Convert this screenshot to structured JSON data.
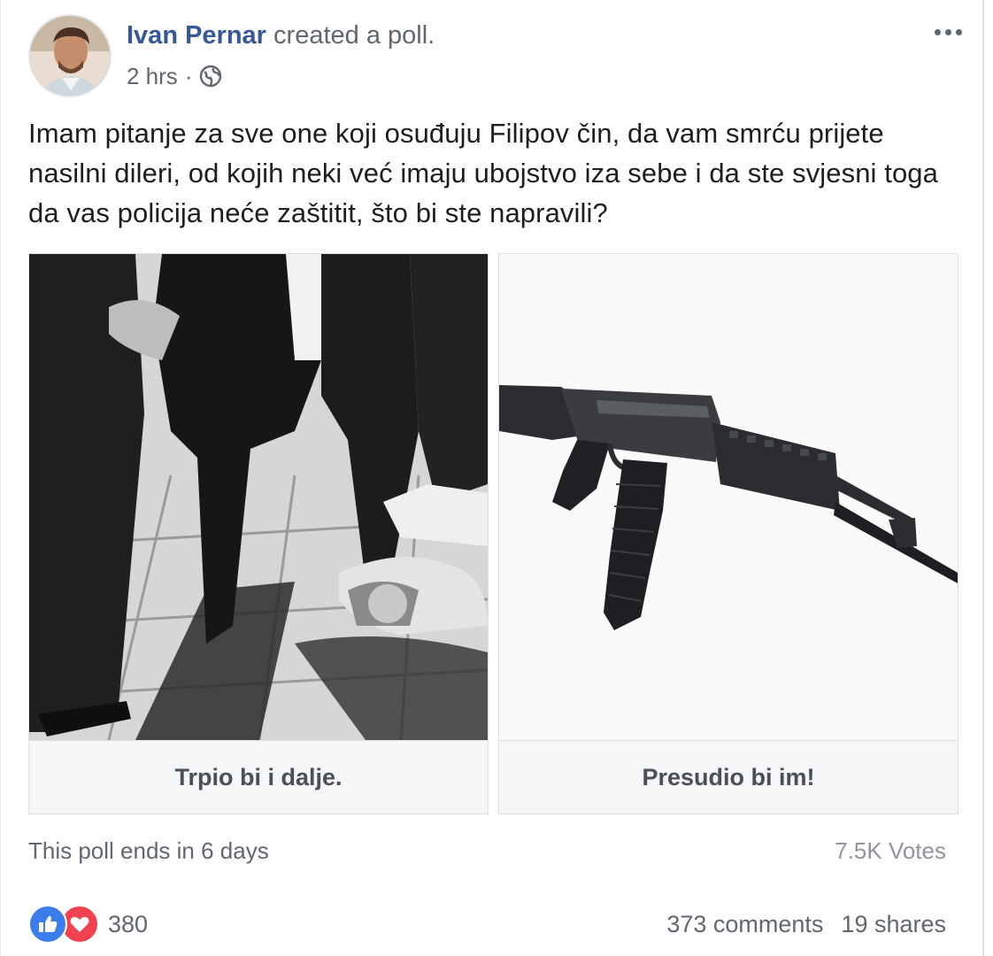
{
  "post": {
    "author": "Ivan Pernar",
    "action": "created a poll.",
    "time": "2 hrs",
    "separator": "·",
    "privacy_icon": "globe-icon",
    "body": "Imam pitanje za sve one koji osuđuju Filipov čin, da vam smrću prijete nasilni dileri, od kojih neki već imaju ubojstvo iza sebe i da ste svjesni toga da vas policija neće zaštitit, što bi ste napravili?"
  },
  "poll": {
    "options": [
      {
        "label": "Trpio bi i dalje.",
        "image": "street-fight-photo"
      },
      {
        "label": "Presudio bi im!",
        "image": "rifle-photo"
      }
    ],
    "ends_text": "This poll ends in 6 days",
    "votes_text": "7.5K Votes"
  },
  "engagement": {
    "reaction_icons": [
      "like-icon",
      "love-icon"
    ],
    "reaction_count": "380",
    "comments": "373 comments",
    "shares": "19 shares"
  },
  "colors": {
    "author_link": "#365899",
    "secondary_text": "#606770",
    "like_blue": "#3b7ded",
    "love_red": "#f0434f"
  }
}
